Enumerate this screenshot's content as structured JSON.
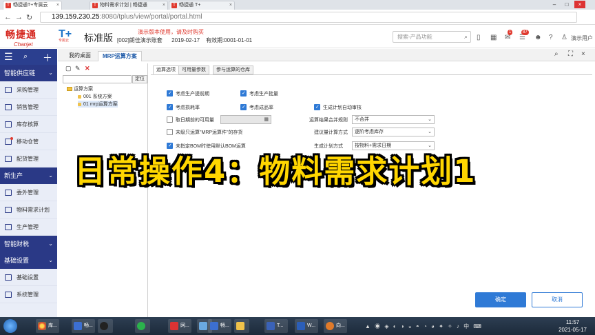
{
  "browser": {
    "tabs": [
      {
        "label": "畅捷通T+专属云"
      },
      {
        "label": "物料需求计划 | 畅捷通"
      },
      {
        "label": "畅捷通 T+"
      }
    ],
    "url_host": "139.159.230.25",
    "url_rest": ":8080/tplus/view/portal/portal.html"
  },
  "header": {
    "brand_cn": "畅捷通",
    "brand_en": "Chanjet",
    "tplus": "T+",
    "tplus_sub": "专属云",
    "edition": "标准版",
    "demo_note": "演示版本使用，请及时购买",
    "account": "[002]",
    "company": "朗佳演示账套",
    "date": "2019-02-17",
    "expiry": "有效期:0001-01-01",
    "search_placeholder": "搜索-产品功能",
    "badge_msg": "1",
    "badge_tasks": "87",
    "user": "演示用户"
  },
  "sidebar": {
    "groups": [
      {
        "label": "智能供应链",
        "items": [
          "采购管理",
          "销售管理",
          "库存核算",
          "移动仓管",
          "配货管理"
        ]
      },
      {
        "label": "新生产",
        "items": [
          "委外管理",
          "物料需求计划",
          "生产管理"
        ]
      },
      {
        "label": "智能财税",
        "items": []
      },
      {
        "label": "基础设置",
        "items": [
          "基础设置",
          "系统管理"
        ]
      }
    ]
  },
  "workspace": {
    "tabs": [
      "我的桌面",
      "MRP运算方案"
    ]
  },
  "left_pane": {
    "locate_label": "定位",
    "tree_root": "运算方案",
    "tree_items": [
      "001 系统方案",
      "01 mrp运算方案"
    ]
  },
  "dialog": {
    "tabs": [
      "运算选项",
      "可用量参数",
      "参与运算的仓库"
    ],
    "options": {
      "consider_lead_time": "考虑生产提前期",
      "consider_batch": "考虑生产批量",
      "consider_loss": "考虑损耗率",
      "consider_finished_rate": "考虑成品率",
      "auto_audit": "生成计划自动审核",
      "use_available_before": "取日期前的可用量",
      "end_level_only": "末级只运算\"MRP运算件\"的存货",
      "use_default_bom": "未指定BOM时使用默认BOM运算",
      "merge_rule_label": "运算结果合并规则",
      "merge_rule_value": "不合并",
      "suggest_calc_label": "建议量计算方式",
      "suggest_calc_value": "逐阶考虑库存",
      "gen_method_label": "生成计划方式",
      "gen_method_value": "按物料+需求日期"
    },
    "ok": "确定",
    "cancel": "取消"
  },
  "overlay_title": "日常操作4：物料需求计划1",
  "taskbar": {
    "apps": [
      "库...",
      "畅...",
      "",
      "",
      "网...",
      "",
      "畅...",
      "",
      "T...",
      "W...",
      "向..."
    ],
    "time": "11:57",
    "date": "2021-05-17"
  }
}
